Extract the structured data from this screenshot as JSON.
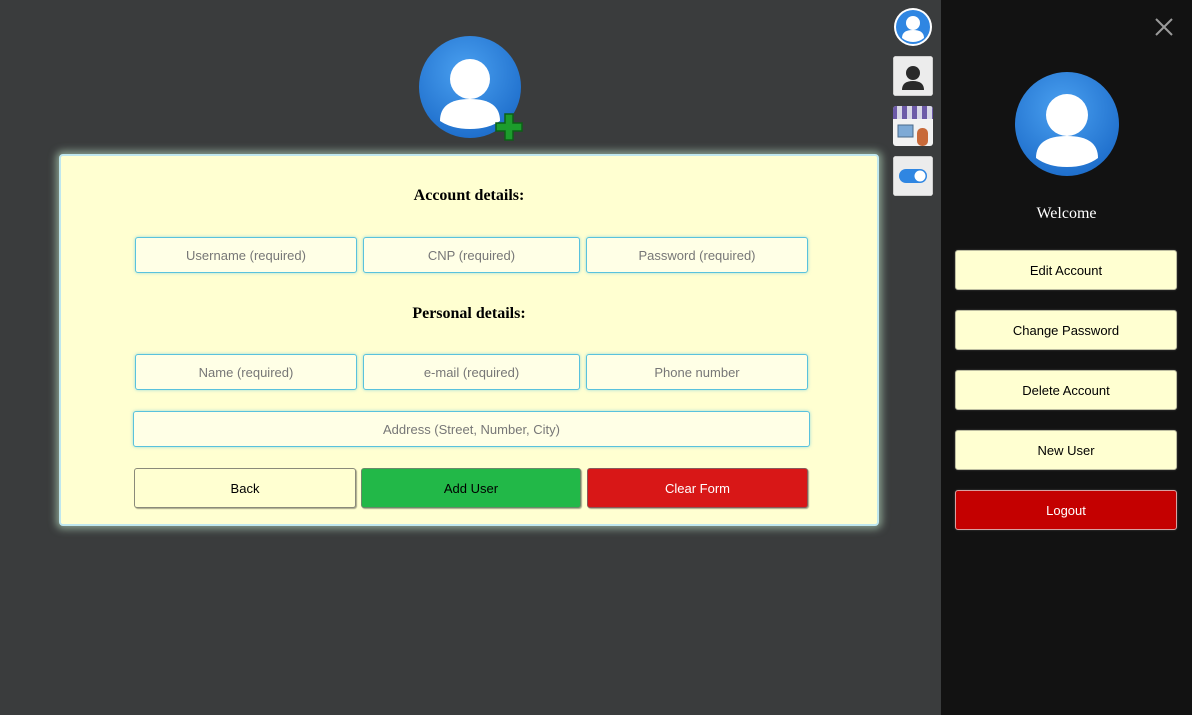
{
  "form": {
    "account_title": "Account details:",
    "personal_title": "Personal details:",
    "fields": {
      "username_placeholder": "Username (required)",
      "cnp_placeholder": "CNP (required)",
      "password_placeholder": "Password (required)",
      "name_placeholder": "Name (required)",
      "email_placeholder": "e-mail (required)",
      "phone_placeholder": "Phone number",
      "address_placeholder": "Address (Street, Number, City)"
    },
    "buttons": {
      "back": "Back",
      "add_user": "Add User",
      "clear_form": "Clear Form"
    }
  },
  "icons": {
    "header": "user-add-icon",
    "side": [
      "user-avatar-icon",
      "user-silhouette-icon",
      "shop-icon",
      "toggle-icon"
    ]
  },
  "drawer": {
    "welcome": "Welcome",
    "buttons": {
      "edit_account": "Edit Account",
      "change_password": "Change Password",
      "delete_account": "Delete Account",
      "new_user": "New User",
      "logout": "Logout"
    }
  },
  "colors": {
    "background": "#3a3c3d",
    "card": "#ffffd1",
    "add": "#22b848",
    "clear": "#d81717",
    "logout": "#c40000",
    "drawer": "#121212",
    "avatar_blue": "#2f86e2"
  }
}
